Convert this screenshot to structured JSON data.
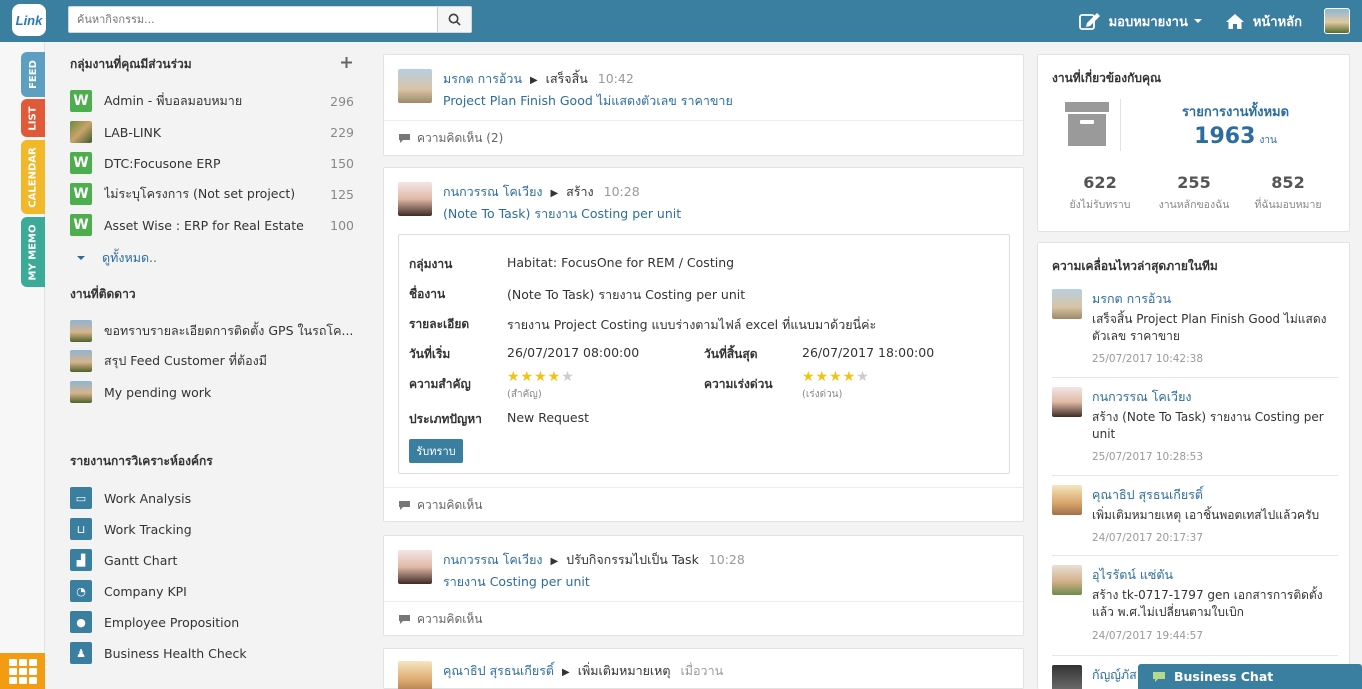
{
  "app": {
    "logo_text": "Link",
    "search_placeholder": "ค้นหากิจกรรม..."
  },
  "topnav": {
    "assign_label": "มอบหมายงาน",
    "home_label": "หน้าหลัก"
  },
  "sidetabs": [
    "FEED",
    "LIST",
    "CALENDAR",
    "MY MEMO"
  ],
  "left": {
    "groups_title": "กลุ่มงานที่คุณมีส่วนร่วม",
    "groups": [
      {
        "label": "Admin - พี่บอลมอบหมาย",
        "count": "296"
      },
      {
        "label": "LAB-LINK",
        "count": "229"
      },
      {
        "label": "DTC:Focusone ERP",
        "count": "150"
      },
      {
        "label": "ไม่ระบุโครงการ (Not set project)",
        "count": "125"
      },
      {
        "label": "Asset Wise : ERP for Real Estate",
        "count": "100"
      }
    ],
    "see_all": "ดูทั้งหมด..",
    "starred_title": "งานที่ติดดาว",
    "starred": [
      {
        "label": "ขอทราบรายละเอียดการติดตั้ง GPS ในรถโค..."
      },
      {
        "label": "สรุป Feed Customer ที่ต้องมี"
      },
      {
        "label": "My pending work"
      }
    ],
    "reports_title": "รายงานการวิเคราะห์องค์กร",
    "reports": [
      {
        "label": "Work Analysis"
      },
      {
        "label": "Work Tracking"
      },
      {
        "label": "Gantt Chart"
      },
      {
        "label": "Company KPI"
      },
      {
        "label": "Employee Proposition"
      },
      {
        "label": "Business Health Check"
      }
    ]
  },
  "feed": {
    "post1": {
      "author": "มรกต การอ้วน",
      "action": "เสร็จสิ้น",
      "time": "10:42",
      "title": "Project Plan Finish Good ไม่แสดงตัวเลข ราคาขาย",
      "comments": "ความคิดเห็น (2)"
    },
    "post2": {
      "author": "กนกวรรณ โคเวียง",
      "action": "สร้าง",
      "time": "10:28",
      "title": "(Note To Task) รายงาน Costing per unit",
      "details": {
        "group_label": "กลุ่มงาน",
        "group_value": "Habitat: FocusOne for REM / Costing",
        "name_label": "ชื่องาน",
        "name_value": "(Note To Task) รายงาน Costing per unit",
        "desc_label": "รายละเอียด",
        "desc_value": "รายงาน Project Costing แบบร่างตามไฟล์ excel ที่แนบมาด้วยนี่ค่ะ",
        "start_label": "วันที่เริ่ม",
        "start_value": "26/07/2017 08:00:00",
        "end_label": "วันที่สิ้นสุด",
        "end_value": "26/07/2017 18:00:00",
        "importance_label": "ความสำคัญ",
        "importance_sub": "(สำคัญ)",
        "importance_stars": 4,
        "urgency_label": "ความเร่งด่วน",
        "urgency_sub": "(เร่งด่วน)",
        "urgency_stars": 4,
        "type_label": "ประเภทปัญหา",
        "type_value": "New Request",
        "ack_button": "รับทราบ"
      },
      "comments": "ความคิดเห็น"
    },
    "post3": {
      "author": "กนกวรรณ โคเวียง",
      "action": "ปรับกิจกรรมไปเป็น Task",
      "time": "10:28",
      "title": "รายงาน Costing per unit",
      "comments": "ความคิดเห็น"
    },
    "post4": {
      "author": "คุณาธิป สุรธนเกียรติ์",
      "action": "เพิ่มเติมหมายเหตุ",
      "time": "เมื่อวาน"
    }
  },
  "right": {
    "related_title": "งานที่เกี่ยวข้องกับคุณ",
    "total_label": "รายการงานทั้งหมด",
    "total_value": "1963",
    "total_unit": "งาน",
    "stats": [
      {
        "num": "622",
        "label": "ยังไม่รับทราบ"
      },
      {
        "num": "255",
        "label": "งานหลักของฉัน"
      },
      {
        "num": "852",
        "label": "ที่ฉันมอบหมาย"
      }
    ],
    "activity_title": "ความเคลื่อนไหวล่าสุดภายในทีม",
    "activities": [
      {
        "name": "มรกต การอ้วน",
        "text": "เสร็จสิ้น Project Plan Finish Good ไม่แสดงตัวเลข ราคาขาย",
        "time": "25/07/2017 10:42:38"
      },
      {
        "name": "กนกวรรณ โคเวียง",
        "text": "สร้าง (Note To Task) รายงาน Costing per unit",
        "time": "25/07/2017 10:28:53"
      },
      {
        "name": "คุณาธิป สุรธนเกียรติ์",
        "text": "เพิ่มเติมหมายเหตุ เอาชิ้นพอตเทสไปแล้วครับ",
        "time": "24/07/2017 20:17:37"
      },
      {
        "name": "อุไรรัตน์ แซ่ตัน",
        "text": "สร้าง tk-0717-1797 gen เอกสารการติดตั้งแล้ว พ.ศ.ไม่เปลี่ยนตามใบเบิก",
        "time": "24/07/2017 19:44:57"
      },
      {
        "name": "กัญญ์ภัส"
      }
    ]
  },
  "chat": {
    "label": "Business Chat"
  }
}
